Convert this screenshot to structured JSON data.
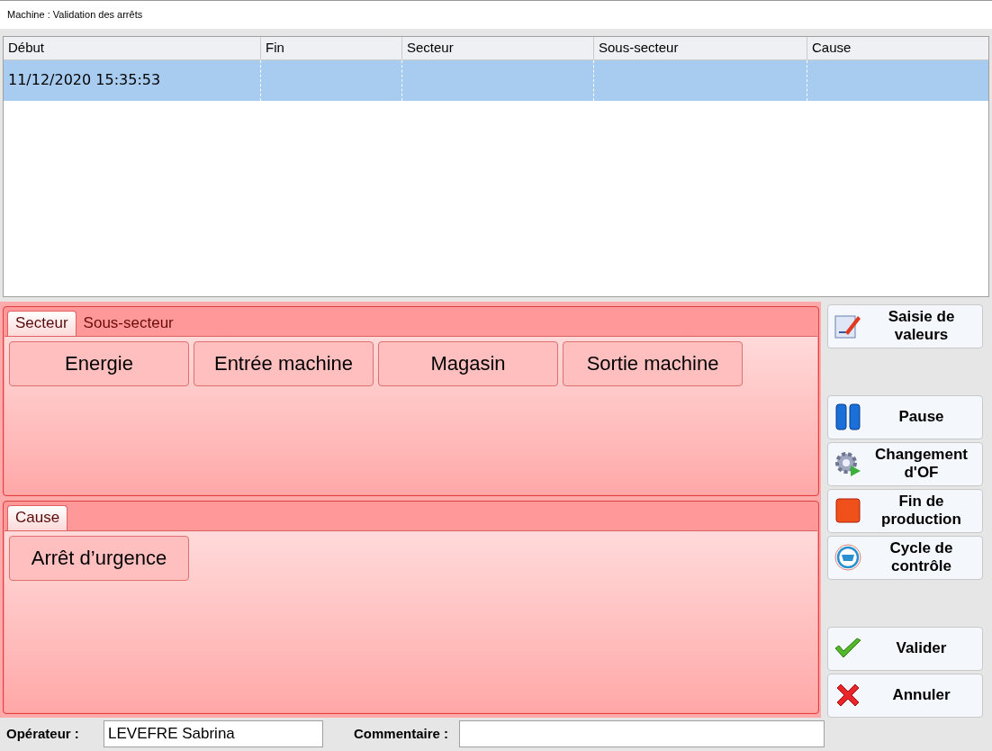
{
  "window": {
    "title": "Machine : Validation des arrêts"
  },
  "table": {
    "columns": [
      "Début",
      "Fin",
      "Secteur",
      "Sous-secteur",
      "Cause"
    ],
    "rows": [
      {
        "selected": true,
        "cells": [
          "11/12/2020 15:35:53",
          "",
          "",
          "",
          ""
        ]
      }
    ]
  },
  "sector_panel": {
    "tabs": [
      {
        "label": "Secteur",
        "selected": true
      },
      {
        "label": "Sous-secteur",
        "selected": false
      }
    ],
    "buttons": [
      "Energie",
      "Entrée machine",
      "Magasin",
      "Sortie machine"
    ]
  },
  "cause_panel": {
    "tabs": [
      {
        "label": "Cause",
        "selected": true
      }
    ],
    "buttons": [
      "Arrêt d’urgence"
    ]
  },
  "side_button_groups": [
    [
      {
        "kind": "edit",
        "label": "Saisie de valeurs"
      }
    ],
    [
      {
        "kind": "pause",
        "label": "Pause"
      },
      {
        "kind": "change",
        "label": "Changement d'OF"
      },
      {
        "kind": "stop",
        "label": "Fin de production"
      },
      {
        "kind": "cycle",
        "label": "Cycle de contrôle"
      }
    ],
    [
      {
        "kind": "ok",
        "label": "Valider"
      },
      {
        "kind": "cancel",
        "label": "Annuler"
      }
    ]
  ],
  "operator": {
    "label": "Opérateur :",
    "value": "LEVEFRE Sabrina"
  },
  "comment": {
    "label": "Commentaire :"
  }
}
